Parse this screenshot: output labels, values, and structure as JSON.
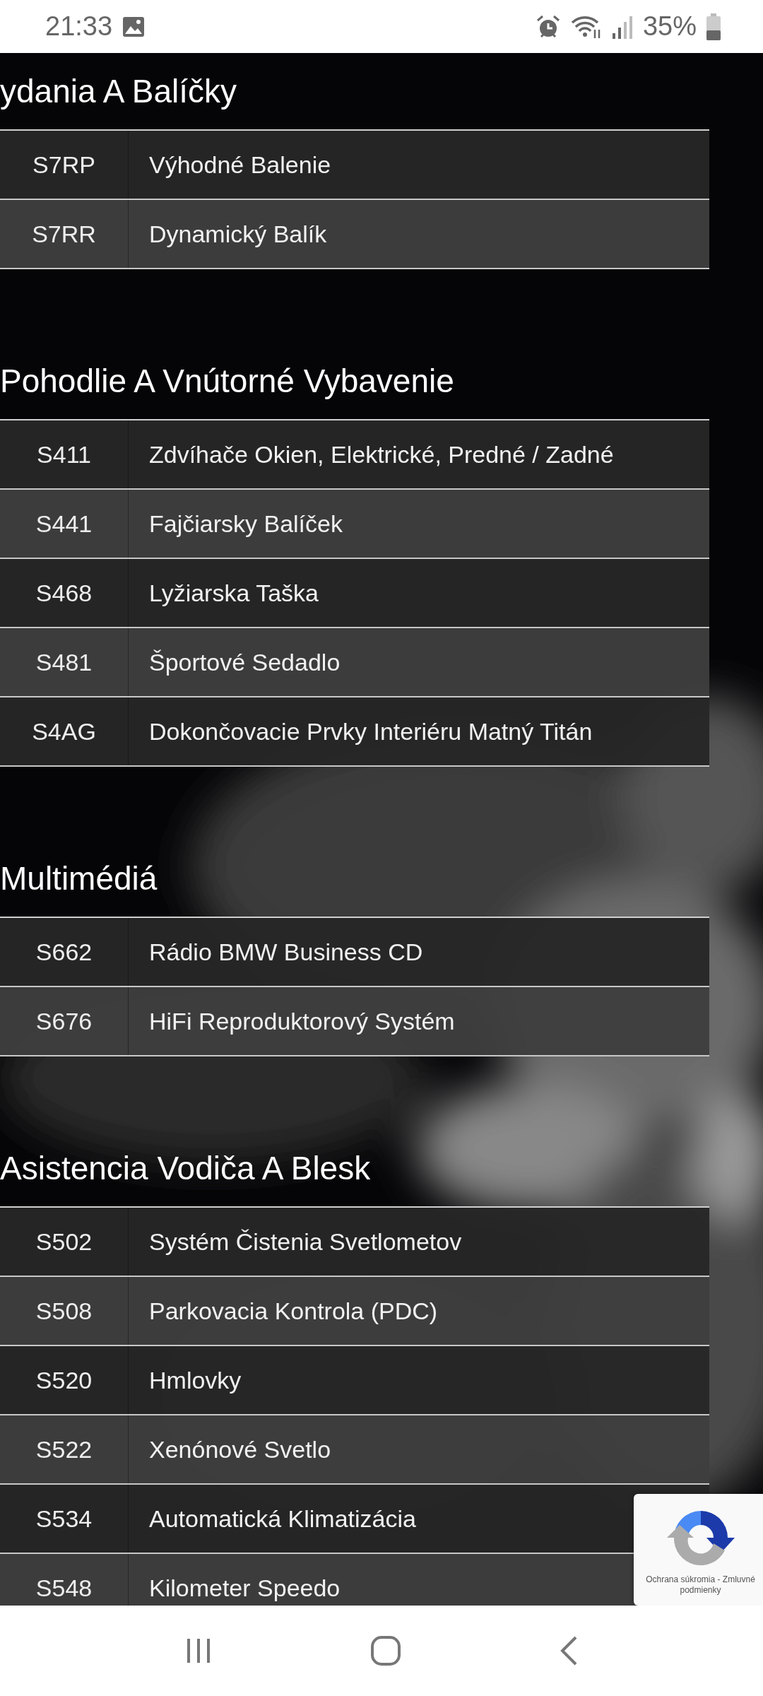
{
  "status_bar": {
    "time": "21:33",
    "battery": "35%"
  },
  "sections": [
    {
      "title": "ydania A Balíčky",
      "rows": [
        {
          "code": "S7RP",
          "name": "Výhodné Balenie"
        },
        {
          "code": "S7RR",
          "name": "Dynamický Balík"
        }
      ]
    },
    {
      "title": "Pohodlie A Vnútorné Vybavenie",
      "rows": [
        {
          "code": "S411",
          "name": "Zdvíhače Okien, Elektrické, Predné / Zadné"
        },
        {
          "code": "S441",
          "name": "Fajčiarsky Balíček"
        },
        {
          "code": "S468",
          "name": "Lyžiarska Taška"
        },
        {
          "code": "S481",
          "name": "Športové Sedadlo"
        },
        {
          "code": "S4AG",
          "name": "Dokončovacie Prvky Interiéru Matný Titán"
        }
      ]
    },
    {
      "title": "Multimédiá",
      "rows": [
        {
          "code": "S662",
          "name": "Rádio BMW Business CD"
        },
        {
          "code": "S676",
          "name": "HiFi Reproduktorový Systém"
        }
      ]
    },
    {
      "title": "Asistencia Vodiča A Blesk",
      "rows": [
        {
          "code": "S502",
          "name": "Systém Čistenia Svetlometov"
        },
        {
          "code": "S508",
          "name": "Parkovacia Kontrola (PDC)"
        },
        {
          "code": "S520",
          "name": "Hmlovky"
        },
        {
          "code": "S522",
          "name": "Xenónové Svetlo"
        },
        {
          "code": "S534",
          "name": "Automatická Klimatizácia"
        },
        {
          "code": "S548",
          "name": "Kilometer Speedo"
        }
      ]
    }
  ],
  "recaptcha": {
    "text": "Ochrana súkromia - Zmluvné podmienky"
  }
}
